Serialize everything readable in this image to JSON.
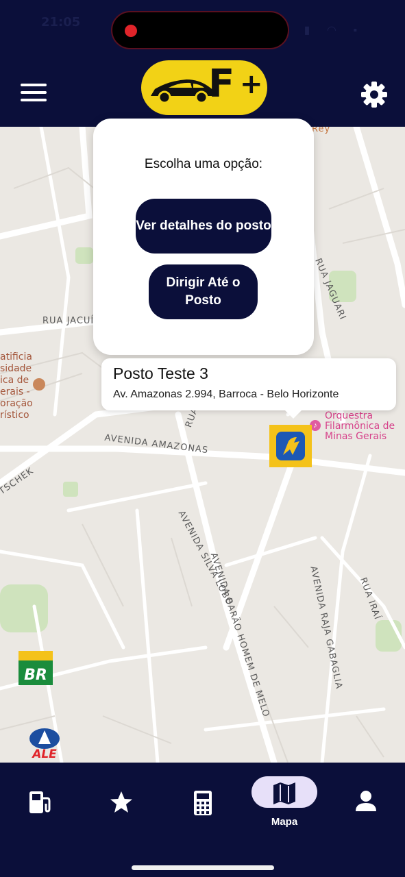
{
  "status_bar": {
    "time": "21:05",
    "icons": "▮ ◠ ▪"
  },
  "header": {
    "logo_text": "F",
    "logo_plus": "+",
    "menu_icon": "hamburger-icon",
    "settings_icon": "gear-icon"
  },
  "map": {
    "streets": [
      "RUA JACUÍ",
      "AVENIDA AMAZONAS",
      "AVENIDA SILVA LOBO",
      "AVENIDA BARÃO HOMEM DE MELO",
      "AVENIDA RAJA GABAGLIA",
      "RUA JAGUARI",
      "RUA IRAÍ",
      "RUA",
      "TSCHEK",
      "Rey"
    ],
    "poi": [
      "Orquestra",
      "Filarmônica de",
      "Minas Gerais"
    ],
    "side_text": [
      "atificia",
      "sidade",
      "ica de",
      "erais -",
      "oração",
      "rístico"
    ]
  },
  "options_dialog": {
    "title": "Escolha uma opção:",
    "details_button": "Ver detalhes do posto",
    "drive_button": "Dirigir Até o Posto"
  },
  "callout": {
    "title": "Posto Teste 3",
    "address": "Av. Amazonas 2.994, Barroca - Belo Horizonte"
  },
  "markers": {
    "br": "BR",
    "ale": "ALE"
  },
  "bottom_nav": {
    "items": [
      {
        "icon": "fuel-pump-icon",
        "label": ""
      },
      {
        "icon": "star-icon",
        "label": ""
      },
      {
        "icon": "calculator-icon",
        "label": ""
      },
      {
        "icon": "map-icon",
        "label": "Mapa",
        "active": true
      },
      {
        "icon": "person-icon",
        "label": ""
      }
    ],
    "active_color": "#e7e0f9"
  },
  "colors": {
    "navy": "#0b0f3a",
    "logo_yellow": "#f2d216",
    "marker_yellow": "#f4c21a",
    "marker_blue": "#1c58b5"
  }
}
